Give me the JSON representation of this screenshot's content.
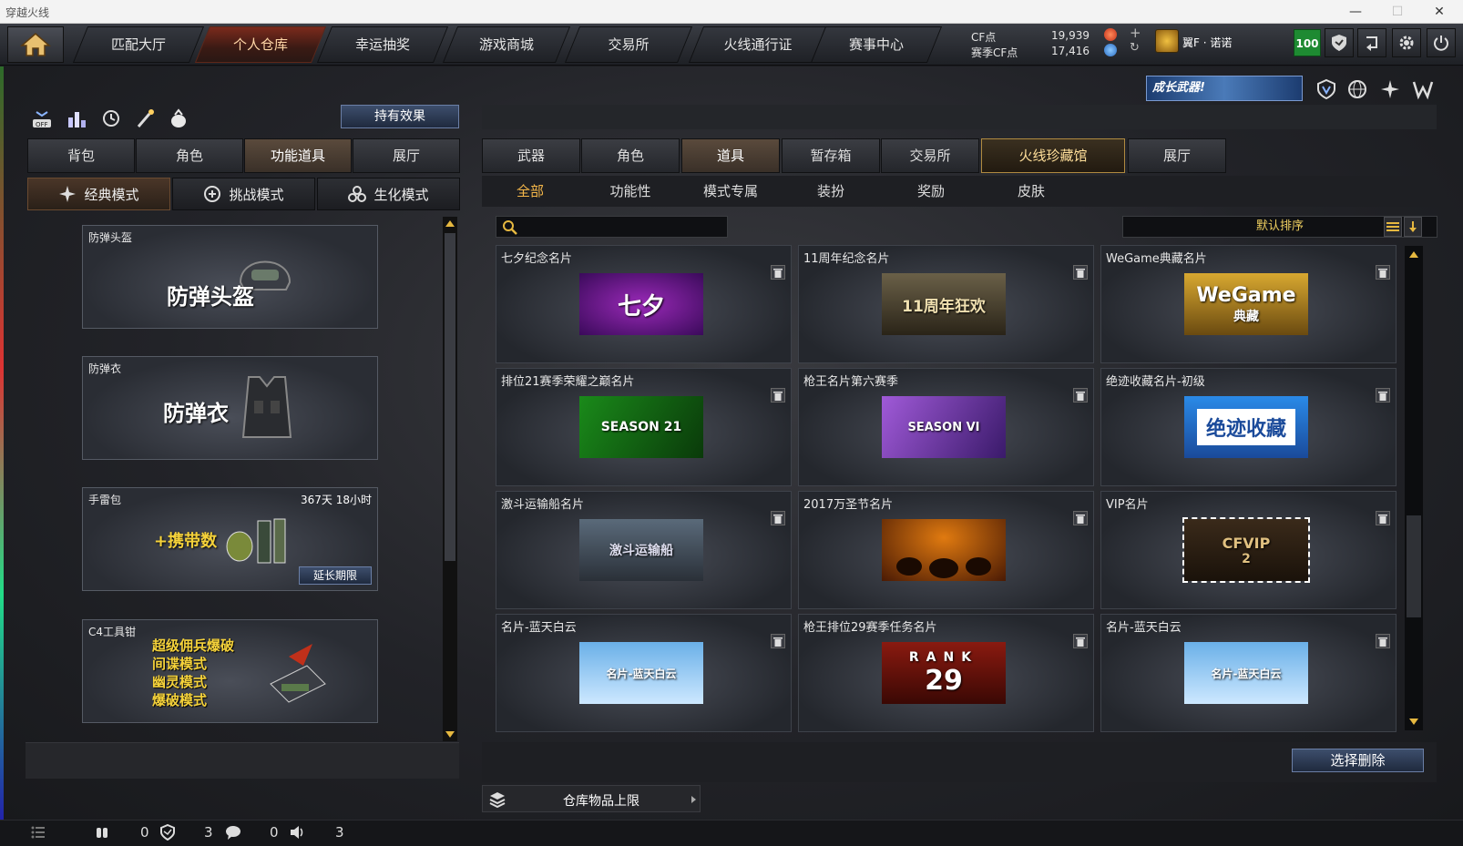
{
  "window": {
    "title": "穿越火线"
  },
  "nav": {
    "tabs": [
      "匹配大厅",
      "个人仓库",
      "幸运抽奖",
      "游戏商城",
      "交易所",
      "火线通行证",
      "赛事中心"
    ],
    "active_index": 1
  },
  "currency": {
    "cf_label": "CF点",
    "cf_value": "19,939",
    "season_label": "赛季CF点",
    "season_value": "17,416"
  },
  "player": {
    "name": "翼F · 诺诺",
    "level_badge": "100"
  },
  "left": {
    "hold_effect_button": "持有效果",
    "tabs": [
      "背包",
      "角色",
      "功能道具",
      "展厅"
    ],
    "active_tab": 2,
    "mode_tabs": [
      "经典模式",
      "挑战模式",
      "生化模式"
    ],
    "items": [
      {
        "name": "防弹头盔",
        "big_text": "防弹头盔"
      },
      {
        "name": "防弹衣",
        "big_text": "防弹衣"
      },
      {
        "name": "手雷包",
        "big_text": "+携带数",
        "duration": "367天 18小时",
        "extend_button": "延长期限"
      },
      {
        "name": "C4工具钳",
        "lines": [
          "超级佣兵爆破",
          "间谍模式",
          "幽灵模式",
          "爆破模式"
        ]
      }
    ]
  },
  "right": {
    "banner": "成长武器!",
    "tabs": [
      "武器",
      "角色",
      "道具",
      "暂存箱",
      "交易所",
      "火线珍藏馆",
      "展厅"
    ],
    "active_tab": 2,
    "highlight_tab": 5,
    "subtabs": [
      "全部",
      "功能性",
      "模式专属",
      "装扮",
      "奖励",
      "皮肤"
    ],
    "active_subtab": 0,
    "search": {
      "placeholder": ""
    },
    "sort_label": "默认排序",
    "cards": [
      {
        "name": "七夕纪念名片",
        "img_text": "七夕"
      },
      {
        "name": "11周年纪念名片",
        "img_text": "11周年狂欢"
      },
      {
        "name": "WeGame典藏名片",
        "img_text": "WeGame",
        "img_sub": "典藏"
      },
      {
        "name": "排位21赛季荣耀之巅名片",
        "img_text": "SEASON 21"
      },
      {
        "name": "枪王名片第六赛季",
        "img_text": "SEASON VI"
      },
      {
        "name": "绝迹收藏名片-初级",
        "img_text": "绝迹收藏"
      },
      {
        "name": "激斗运输船名片",
        "img_text": "激斗运输船"
      },
      {
        "name": "2017万圣节名片",
        "img_text": ""
      },
      {
        "name": "VIP名片",
        "img_text": "CFVIP",
        "img_sub": "2"
      },
      {
        "name": "名片-蓝天白云",
        "img_text": "名片-蓝天白云"
      },
      {
        "name": "枪王排位29赛季任务名片",
        "img_text": "RANK",
        "img_sub": "29"
      },
      {
        "name": "名片-蓝天白云",
        "img_text": "名片-蓝天白云"
      }
    ],
    "delete_button": "选择删除",
    "capacity_label": "仓库物品上限"
  },
  "statusbar": {
    "values": [
      "0",
      "3",
      "0",
      "3"
    ]
  }
}
